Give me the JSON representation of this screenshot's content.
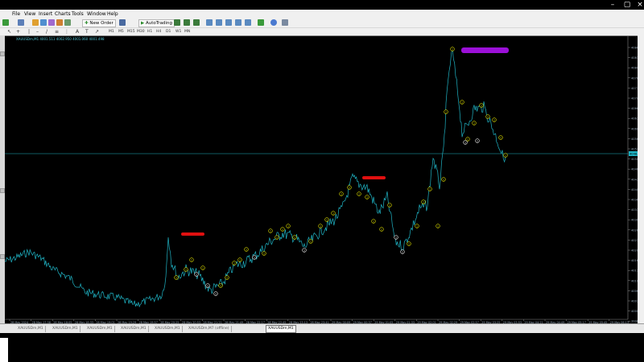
{
  "menu": [
    "File",
    "View",
    "Insert",
    "Charts",
    "Tools",
    "Window",
    "Help"
  ],
  "toolbar": {
    "new_order": "New Order",
    "auto_trading": "AutoTrading"
  },
  "timeframes": [
    "M1",
    "M5",
    "M15",
    "M30",
    "H1",
    "H4",
    "D1",
    "W1",
    "MN"
  ],
  "chart": {
    "info": "XAUUSDm,M1  4001.511 4002.950 4001.060 4001.498",
    "price_axis": [
      "4086.800",
      "4083.470",
      "4080.140",
      "4076.810",
      "4073.480",
      "4070.150",
      "4066.820",
      "4063.490",
      "4060.160",
      "4056.830",
      "4053.500",
      "4050.170",
      "4046.840",
      "4043.510",
      "4040.180",
      "4036.850",
      "4033.520",
      "4030.190",
      "4026.860",
      "4023.530",
      "4020.200",
      "4016.870",
      "4013.540",
      "4010.210",
      "4006.880",
      "4003.550",
      "4000.220",
      "3996.890",
      "3993.560"
    ],
    "current_price": "4048.998",
    "time_axis": [
      "28 May 2024",
      "28 May 17:38",
      "28 May 18:05",
      "28 May 18:33",
      "28 May 19:01",
      "28 May 19:29",
      "28 May 19:57",
      "28 May 20:25",
      "28 May 20:53",
      "28 May 21:21",
      "28 May 21:49",
      "28 May 22:17",
      "28 May 22:45",
      "28 May 23:13",
      "28 May 23:41",
      "29 May 00:09",
      "29 May 00:37",
      "29 May 01:05",
      "29 May 01:33",
      "29 May 02:01",
      "29 May 02:29",
      "29 May 02:57",
      "29 May 03:25",
      "29 May 03:53",
      "29 May 04:21",
      "29 May 04:49",
      "29 May 05:17",
      "29 May 05:45",
      "29 May 06:13"
    ],
    "wave_label": "1",
    "colors": {
      "line": "#1fb3c4",
      "marker": "#d6d600",
      "red_bar": "#e01010",
      "purple_bar": "#9b10d8",
      "grid": "#1fb3c4"
    }
  },
  "tabs": [
    "XAUUSDm,M1",
    "XAUUSDm,M1",
    "XAUUSDm,M1",
    "XAUUSDm,M1",
    "XAUUSDm,M1",
    "XAUUSDm,M7 (offline)",
    "XAUUSDm,M1"
  ]
}
